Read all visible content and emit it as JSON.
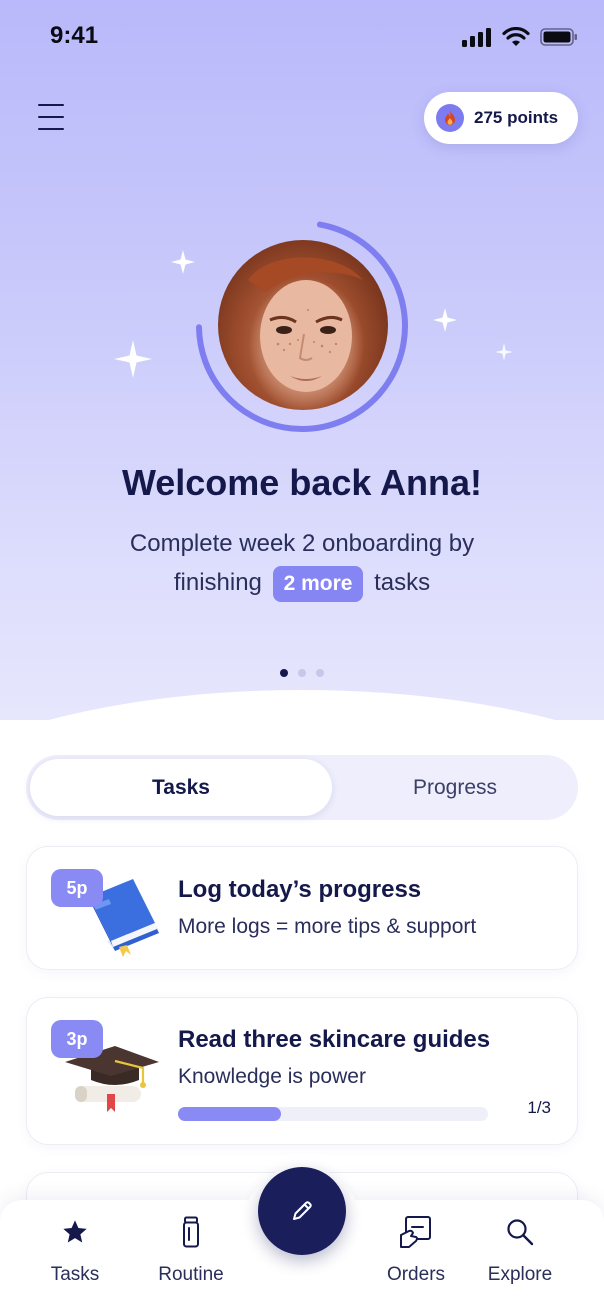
{
  "status_bar": {
    "time": "9:41"
  },
  "header": {
    "points_label": "275 points"
  },
  "hero": {
    "title": "Welcome back Anna!",
    "subtitle_line1": "Complete week 2 onboarding by",
    "subtitle_line2_before": "finishing",
    "highlight": "2 more",
    "subtitle_line2_after": "tasks",
    "ring_progress": 0.72,
    "pager": {
      "count": 3,
      "active_index": 0
    }
  },
  "tabs": [
    {
      "label": "Tasks",
      "active": true
    },
    {
      "label": "Progress",
      "active": false
    }
  ],
  "tasks": [
    {
      "points": "5p",
      "title": "Log today’s progress",
      "subtitle": "More logs = more tips & support",
      "icon": "book-icon"
    },
    {
      "points": "3p",
      "title": "Read three skincare guides",
      "subtitle": "Knowledge is power",
      "progress_label": "1/3",
      "progress": 0.333,
      "icon": "graduation-cap-icon"
    }
  ],
  "bottom_nav": {
    "items": [
      {
        "label": "Tasks",
        "icon": "star-icon",
        "active": true
      },
      {
        "label": "Routine",
        "icon": "bottle-icon",
        "active": false
      },
      {
        "label": "Orders",
        "icon": "orders-icon",
        "active": false
      },
      {
        "label": "Explore",
        "icon": "search-icon",
        "active": false
      }
    ],
    "fab_icon": "pencil-icon"
  },
  "colors": {
    "accent": "#8a8af5",
    "navy": "#14184a",
    "hero_top": "#b9b9fb",
    "hero_bottom": "#e6e6fd"
  }
}
